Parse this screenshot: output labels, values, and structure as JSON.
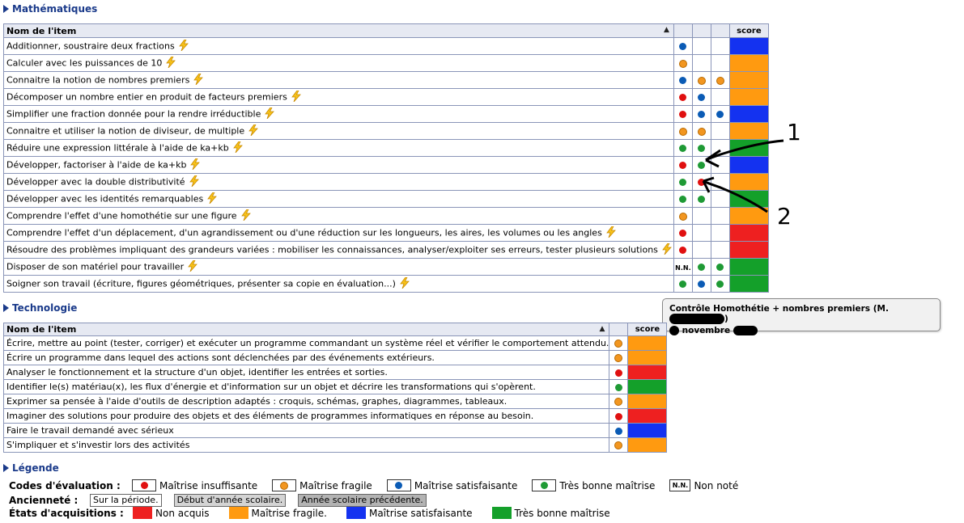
{
  "math": {
    "title": "Mathématiques",
    "header": {
      "name": "Nom de l'item",
      "score": "score"
    },
    "rows": [
      {
        "label": "Additionner, soustraire deux fractions",
        "dots": [
          "blue"
        ],
        "score": "blue"
      },
      {
        "label": "Calculer avec les puissances de 10",
        "dots": [
          "orange"
        ],
        "score": "orange"
      },
      {
        "label": "Connaitre la notion de nombres premiers",
        "dots": [
          "blue",
          "orange",
          "orange"
        ],
        "score": "orange"
      },
      {
        "label": "Décomposer un nombre entier en produit de facteurs premiers",
        "dots": [
          "red",
          "blue"
        ],
        "score": "orange"
      },
      {
        "label": "Simplifier une fraction donnée pour la rendre irréductible",
        "dots": [
          "red",
          "blue",
          "blue"
        ],
        "score": "blue"
      },
      {
        "label": "Connaitre et utiliser la notion de diviseur, de multiple",
        "dots": [
          "orange",
          "orange"
        ],
        "score": "orange"
      },
      {
        "label": "Réduire une expression littérale à l'aide de ka+kb",
        "dots": [
          "green",
          "green"
        ],
        "score": "green"
      },
      {
        "label": "Développer, factoriser à l'aide de ka+kb",
        "dots": [
          "red",
          "green"
        ],
        "score": "blue"
      },
      {
        "label": "Développer avec la double distributivité",
        "dots": [
          "green",
          "red"
        ],
        "score": "orange"
      },
      {
        "label": "Développer avec les identités remarquables",
        "dots": [
          "green",
          "green"
        ],
        "score": "green"
      },
      {
        "label": "Comprendre l'effet d'une homothétie sur une figure",
        "dots": [
          "orange"
        ],
        "score": "orange"
      },
      {
        "label": "Comprendre l'effet d'un déplacement, d'un agrandissement ou d'une réduction sur les longueurs, les aires, les volumes ou les angles",
        "dots": [
          "red"
        ],
        "score": "red"
      },
      {
        "label": "Résoudre des problèmes impliquant des grandeurs variées : mobiliser les connaissances, analyser/exploiter ses erreurs, tester plusieurs solutions",
        "dots": [
          "red"
        ],
        "score": "red"
      },
      {
        "label": "Disposer de son matériel pour travailler",
        "dots": [
          "nn",
          "green",
          "green"
        ],
        "score": "green"
      },
      {
        "label": "Soigner son travail (écriture, figures géométriques, présenter sa copie en évaluation...)",
        "dots": [
          "green",
          "blue",
          "green"
        ],
        "score": "green"
      }
    ]
  },
  "tech": {
    "title": "Technologie",
    "header": {
      "name": "Nom de l'item",
      "score": "score"
    },
    "rows": [
      {
        "label": "Écrire, mettre au point (tester, corriger) et exécuter un programme commandant un système réel et vérifier le comportement attendu.",
        "dot": "orange",
        "score": "orange"
      },
      {
        "label": "Écrire un programme dans lequel des actions sont déclenchées par des événements extérieurs.",
        "dot": "orange",
        "score": "orange"
      },
      {
        "label": "Analyser le fonctionnement et la structure d'un objet, identifier les entrées et sorties.",
        "dot": "red",
        "score": "red"
      },
      {
        "label": "Identifier le(s) matériau(x), les flux d'énergie et d'information sur un objet et décrire les transformations qui s'opèrent.",
        "dot": "green",
        "score": "green"
      },
      {
        "label": "Exprimer sa pensée à l'aide d'outils de description adaptés : croquis, schémas, graphes, diagrammes, tableaux.",
        "dot": "orange",
        "score": "orange"
      },
      {
        "label": "Imaginer des solutions pour produire des objets et des éléments de programmes informatiques en réponse au besoin.",
        "dot": "red",
        "score": "red"
      },
      {
        "label": "Faire le travail demandé avec sérieux",
        "dot": "blue",
        "score": "blue"
      },
      {
        "label": "S'impliquer et s'investir lors des activités",
        "dot": "orange",
        "score": "orange"
      }
    ]
  },
  "tooltip": {
    "line1": "Contrôle Homothétie + nombres premiers (M.",
    "line1_end": ")",
    "line2": "novembre"
  },
  "annotations": {
    "one": "1",
    "two": "2"
  },
  "legend": {
    "title": "Légende",
    "codes_label": "Codes d'évaluation :",
    "codes": [
      {
        "color": "red",
        "label": "Maîtrise insuffisante"
      },
      {
        "color": "orange",
        "label": "Maîtrise fragile"
      },
      {
        "color": "blue",
        "label": "Maîtrise satisfaisante"
      },
      {
        "color": "green",
        "label": "Très bonne maîtrise"
      },
      {
        "color": "nn",
        "label": "Non noté"
      }
    ],
    "nn_code": "N.N.",
    "anciennete_label": "Ancienneté :",
    "anciennete": [
      "Sur la période.",
      "Début d'année scolaire.",
      "Année scolaire précédente."
    ],
    "etats_label": "États d'acquisitions :",
    "etats": [
      {
        "color": "red",
        "label": "Non acquis"
      },
      {
        "color": "orange",
        "label": "Maîtrise fragile."
      },
      {
        "color": "blue",
        "label": "Maîtrise satisfaisante"
      },
      {
        "color": "green",
        "label": "Très bonne maîtrise"
      }
    ]
  },
  "colors": {
    "dot_red": "#e01010",
    "dot_orange": "#f29620",
    "dot_blue": "#0b5bb5",
    "dot_green": "#1f9a35",
    "score_blue": "#1432f0",
    "score_orange": "#ff9a10",
    "score_green": "#14a02a",
    "score_red": "#ee2020"
  },
  "icons": {
    "item_action": "lightning-icon",
    "collapse": "triangle-right-icon",
    "sort": "sort-icon"
  }
}
